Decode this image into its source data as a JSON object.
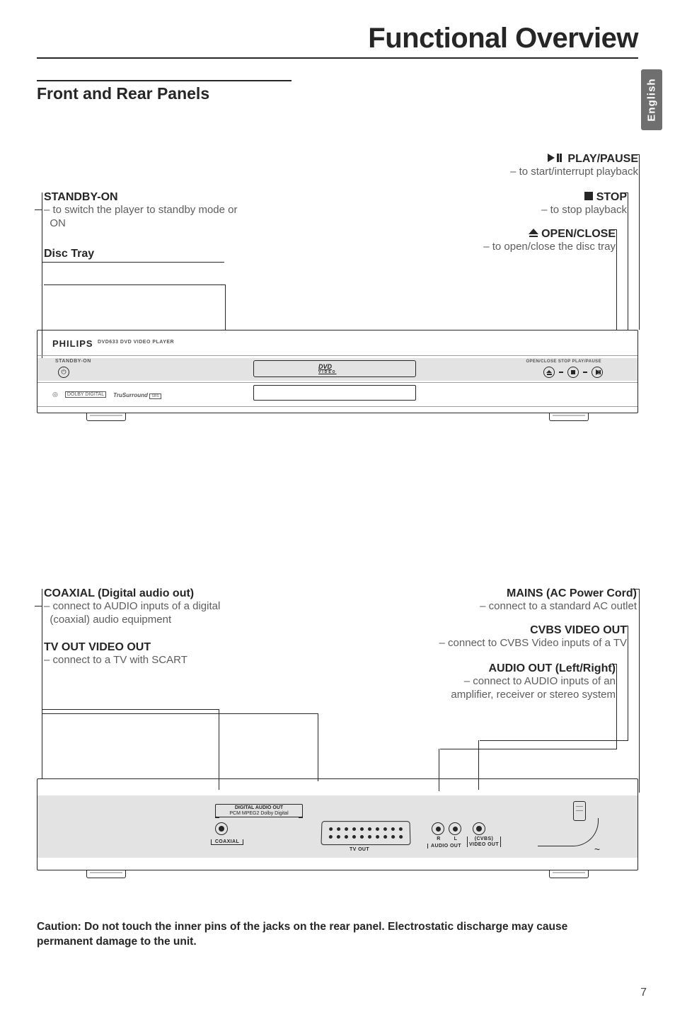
{
  "page": {
    "title": "Functional Overview",
    "lang_tab": "English",
    "section_heading": "Front and Rear Panels",
    "caution": "Caution: Do not touch the inner pins of the jacks on the rear panel. Electrostatic discharge may cause permanent damage to the unit.",
    "page_number": "7"
  },
  "front": {
    "play_pause": {
      "title": "PLAY/PAUSE",
      "desc": "– to start/interrupt playback"
    },
    "stop": {
      "title": "STOP",
      "desc": "– to stop playback"
    },
    "open_close": {
      "title": "OPEN/CLOSE",
      "desc": "– to open/close the disc tray"
    },
    "standby_on": {
      "title": "STANDBY-ON",
      "desc1": "– to switch the player to standby mode or",
      "desc2": "ON"
    },
    "disc_tray": {
      "title": "Disc Tray"
    },
    "device": {
      "brand": "PHILIPS",
      "model": "DVD633 DVD VIDEO PLAYER",
      "standby_label": "STANDBY-ON",
      "dvd_logo_top": "DVD",
      "dvd_logo_bottom": "VIDEO",
      "btn_row_label": "OPEN/CLOSE   STOP   PLAY/PAUSE",
      "dolby_box": "DOLBY DIGITAL",
      "trusurround": "TruSurround",
      "srs_box": "SRS"
    }
  },
  "rear": {
    "coaxial": {
      "title": "COAXIAL (Digital audio out)",
      "desc1": "– connect to AUDIO inputs of a digital",
      "desc2": "(coaxial) audio equipment"
    },
    "tvout": {
      "title": "TV OUT VIDEO OUT",
      "desc": "– connect to a TV with SCART"
    },
    "mains": {
      "title": "MAINS (AC Power Cord)",
      "desc": "– connect to a standard AC outlet"
    },
    "cvbs": {
      "title": "CVBS VIDEO OUT",
      "desc": "– connect to CVBS Video inputs of a TV"
    },
    "audio": {
      "title": "AUDIO OUT (Left/Right)",
      "desc1": "– connect to AUDIO inputs of an",
      "desc2": "amplifier, receiver or stereo system"
    },
    "device": {
      "dig_audio_label_top": "DIGITAL AUDIO OUT",
      "dig_audio_label_bottom": "PCM MPEG2 Dolby Digital",
      "coaxial_label": "COAXIAL",
      "tvout_label": "TV OUT",
      "audio_R": "R",
      "audio_L": "L",
      "audio_out_label": "AUDIO OUT",
      "cvbs_label_top": "(CVBS)",
      "cvbs_label_bottom": "VIDEO OUT",
      "tilde": "~"
    }
  }
}
